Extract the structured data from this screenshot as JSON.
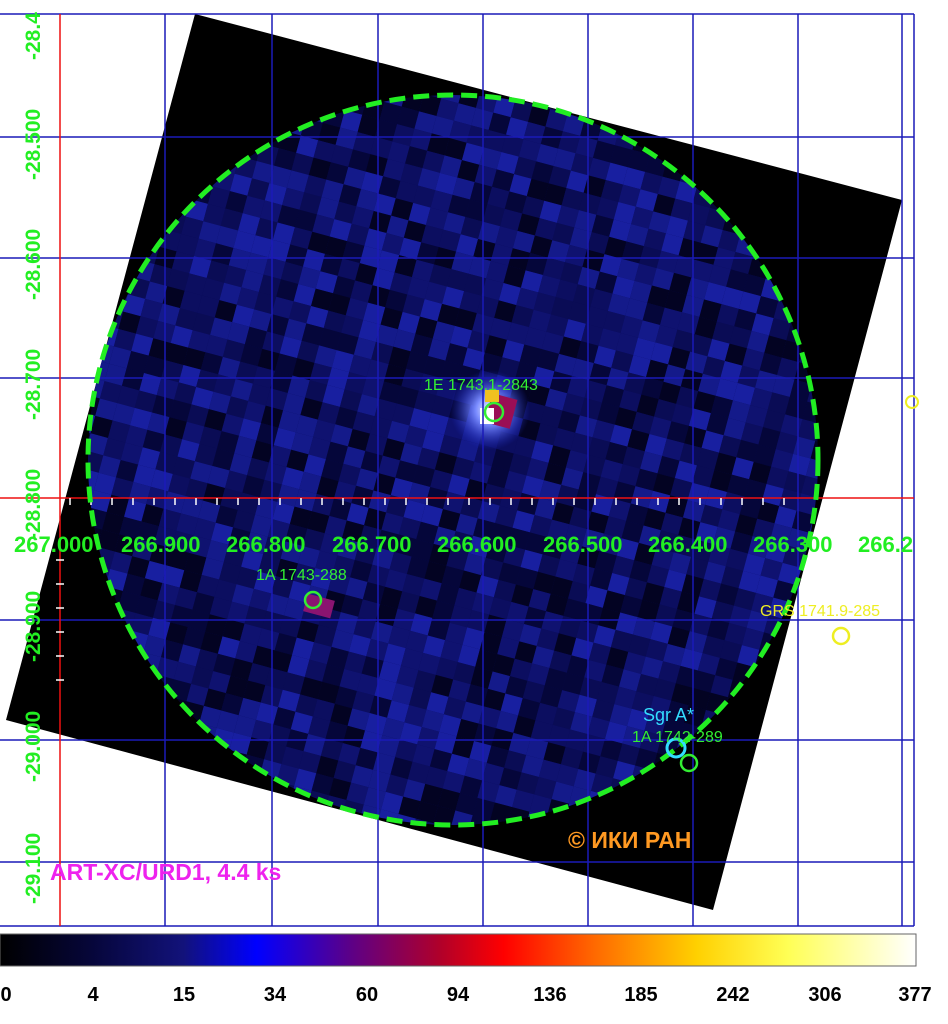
{
  "image": {
    "instrument_label": "ART-XC/URD1, 4.4 ks",
    "copyright": "© ИКИ РАН"
  },
  "grid": {
    "ra_ticks": [
      "267.000",
      "266.900",
      "266.800",
      "266.700",
      "266.600",
      "266.500",
      "266.400",
      "266.300",
      "266.2"
    ],
    "dec_ticks": [
      "-28.4",
      "-28.500",
      "-28.600",
      "-28.700",
      "-28.800",
      "-28.900",
      "-29.000",
      "-29.100"
    ]
  },
  "sources": [
    {
      "name": "1E 1743.1-2843",
      "color": "#33ee33"
    },
    {
      "name": "1A 1743-288",
      "color": "#33ee33"
    },
    {
      "name": "GRS 1741.9-285",
      "color": "#eeee22"
    },
    {
      "name": "Sgr A*",
      "color": "#33ddff"
    },
    {
      "name": "1A 1742-289",
      "color": "#33ee33"
    }
  ],
  "colorbar": {
    "labels": [
      "0",
      "4",
      "15",
      "34",
      "60",
      "94",
      "136",
      "185",
      "242",
      "306",
      "377"
    ]
  },
  "colors": {
    "grid": "#1a1ab8",
    "axis": "#ee1111",
    "fov": "#22ee22",
    "instrument": "#ee22ee",
    "copyright": "#ff9922"
  }
}
